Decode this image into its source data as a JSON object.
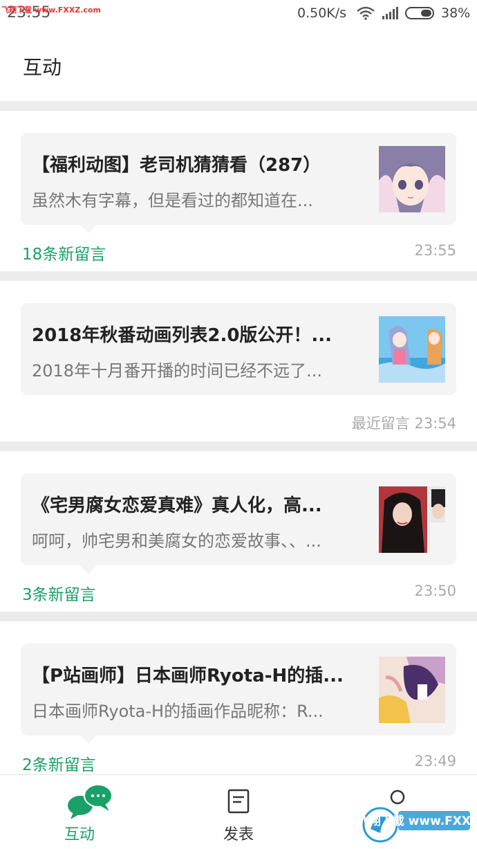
{
  "status_bar": {
    "time": "23:55",
    "watermark": "飞翔下载 www.FXXZ.com",
    "speed": "0.50K/s",
    "battery": "38%",
    "icons": [
      "wifi-icon",
      "signal-icon",
      "battery-icon"
    ]
  },
  "header": {
    "title": "互动"
  },
  "items": [
    {
      "title": "【福利动图】老司机猜猜看（287）",
      "desc": "虽然木有字幕，但是看过的都知道在...",
      "comment_label": "18条新留言",
      "time": "23:55",
      "thumb": "anime-girl-purple-hair-image"
    },
    {
      "title": "2018年秋番动画列表2.0版公开！...",
      "desc": "2018年十月番开播的时间已经不远了...",
      "comment_label": "",
      "time_label": "最近留言",
      "time": "23:54",
      "thumb": "anime-beach-image"
    },
    {
      "title": "《宅男腐女恋爱真难》真人化，高...",
      "desc": "呵呵，帅宅男和美腐女的恋爱故事、、...",
      "comment_label": "3条新留言",
      "time": "23:50",
      "thumb": "live-action-cast-image"
    },
    {
      "title": "【P站画师】日本画师Ryota-H的插...",
      "desc": "日本画师Ryota-H的插画作品昵称：R...",
      "comment_label": "2条新留言",
      "time": "23:49",
      "thumb": "illustration-image"
    }
  ],
  "bottom_nav": {
    "tabs": [
      {
        "label": "互动",
        "icon": "chat-bubbles-icon",
        "active": true
      },
      {
        "label": "发表",
        "icon": "document-icon",
        "active": false
      },
      {
        "label": "",
        "icon": "profile-icon",
        "active": false
      }
    ],
    "watermark_logo": "飞翔下载 www.FXXZ.com"
  },
  "colors": {
    "accent": "#1aa068",
    "separator": "#ececec",
    "bubble": "#f4f4f4"
  }
}
